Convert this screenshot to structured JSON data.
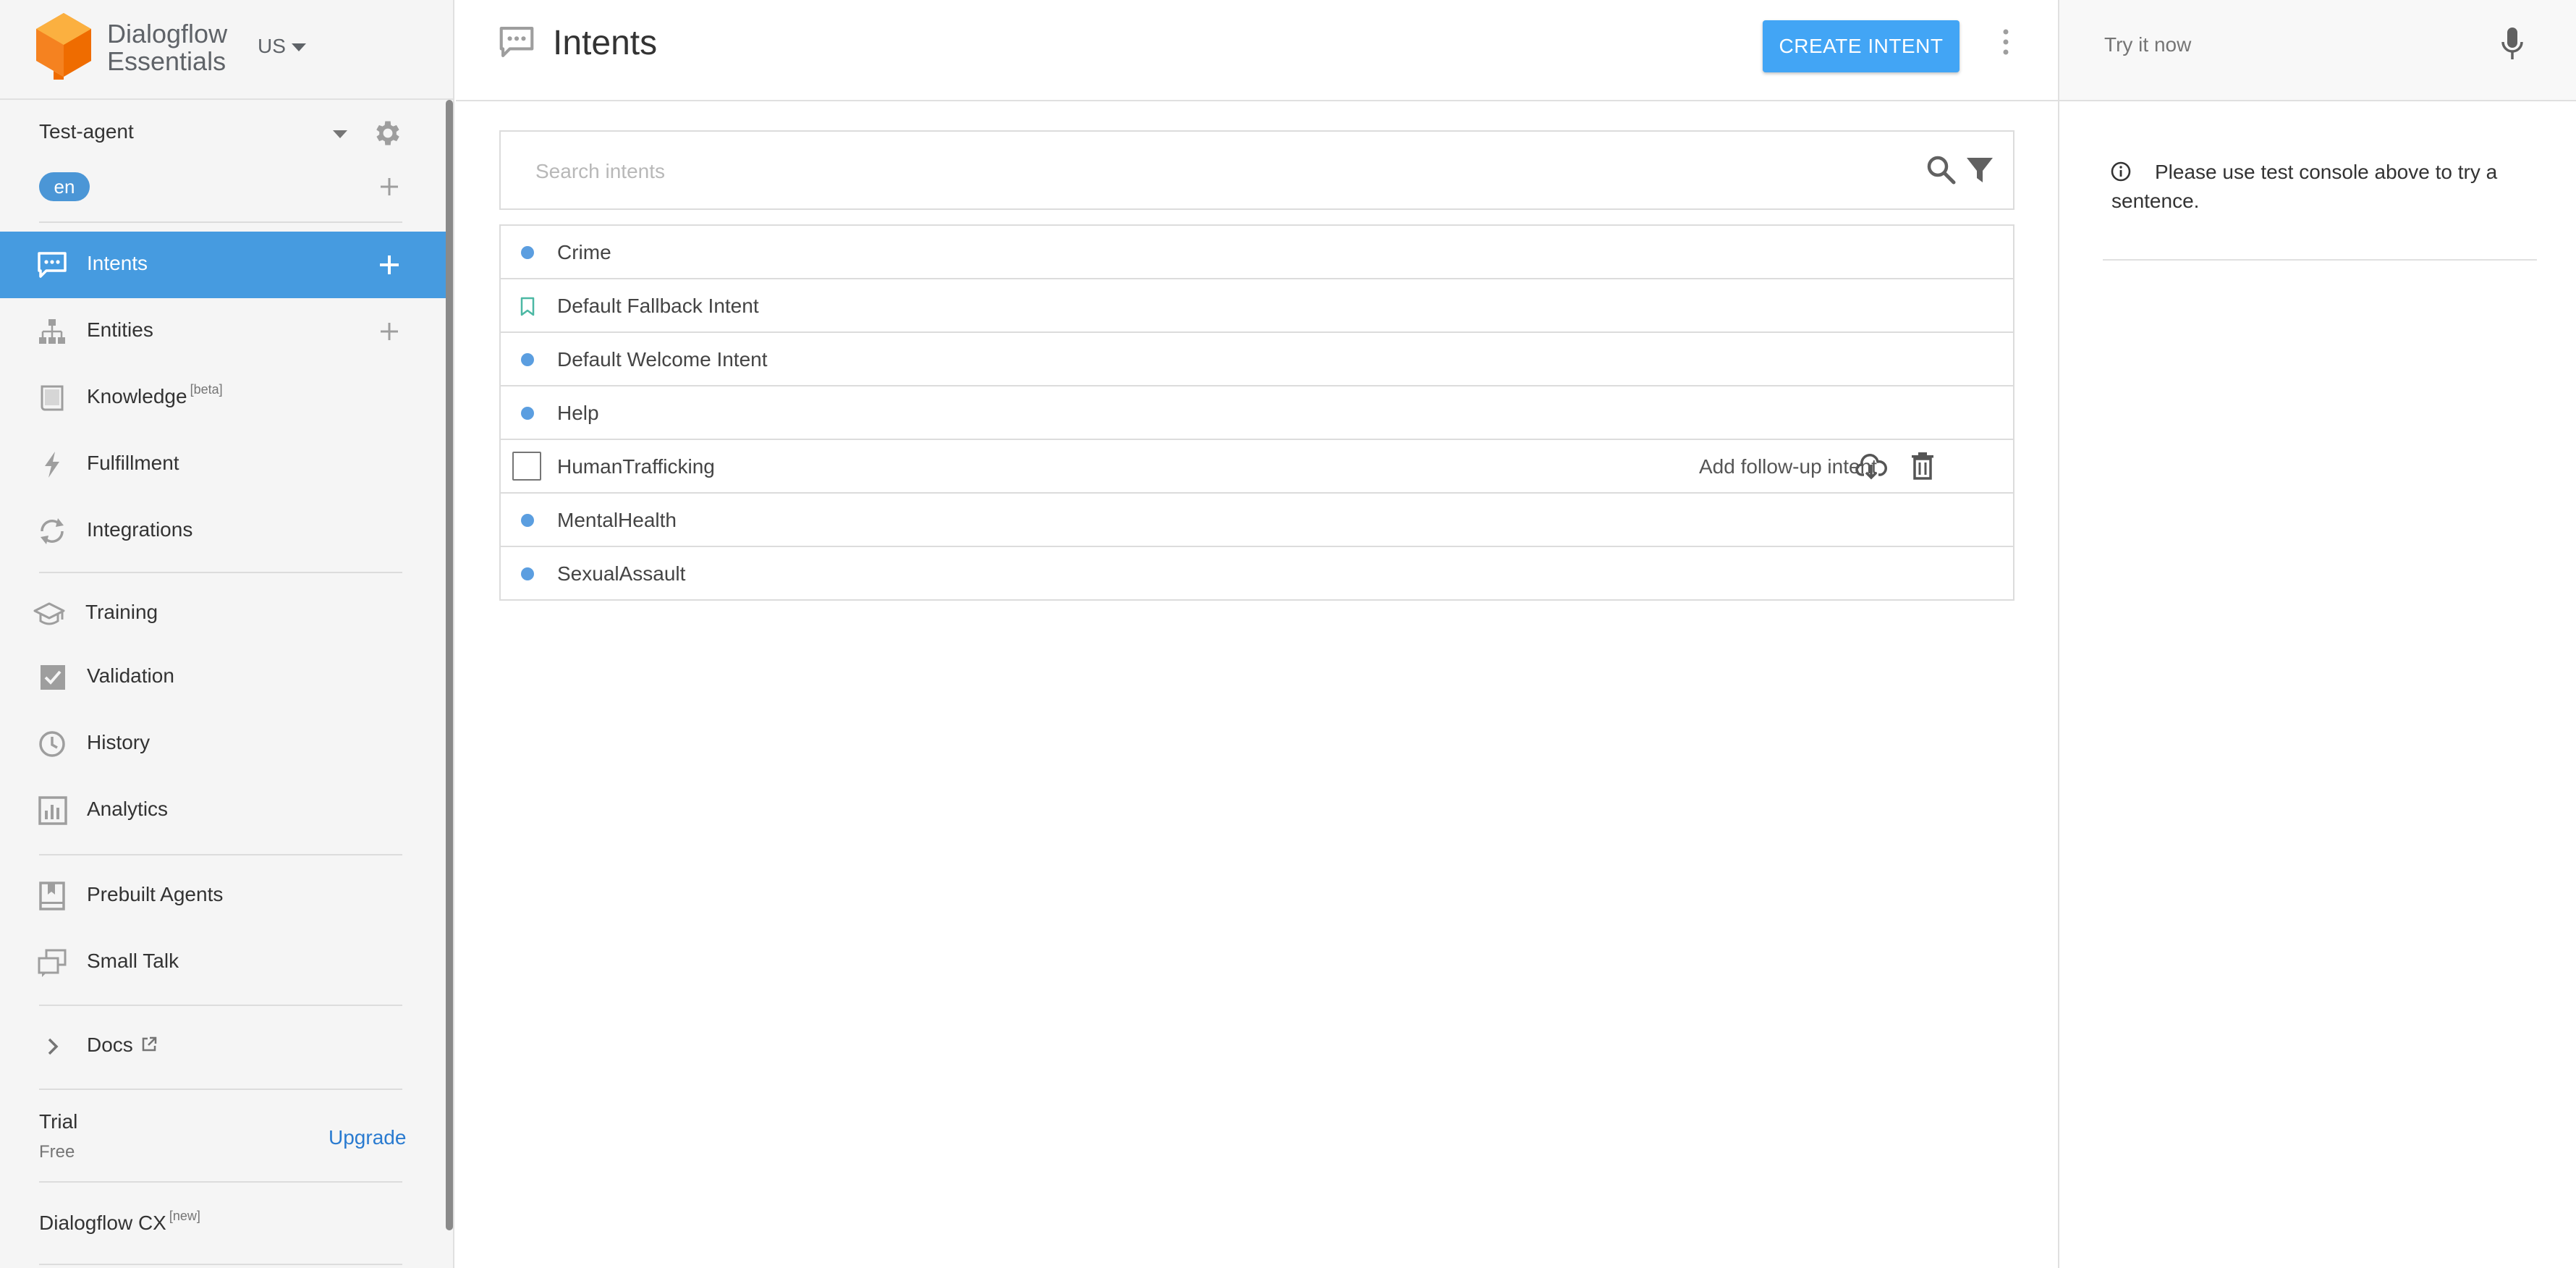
{
  "brand": {
    "line1": "Dialogflow",
    "line2": "Essentials",
    "region": "US"
  },
  "agent": {
    "name": "Test-agent",
    "language": "en"
  },
  "nav": {
    "intents": "Intents",
    "entities": "Entities",
    "knowledge": "Knowledge",
    "knowledge_tag": "[beta]",
    "fulfillment": "Fulfillment",
    "integrations": "Integrations",
    "training": "Training",
    "validation": "Validation",
    "history": "History",
    "analytics": "Analytics",
    "prebuilt_agents": "Prebuilt Agents",
    "small_talk": "Small Talk",
    "docs": "Docs"
  },
  "plan": {
    "label": "Trial",
    "sub": "Free",
    "upgrade": "Upgrade"
  },
  "cx": {
    "label": "Dialogflow CX",
    "tag": "[new]"
  },
  "header": {
    "title": "Intents",
    "create_button": "CREATE INTENT"
  },
  "search": {
    "placeholder": "Search intents"
  },
  "intents": [
    {
      "name": "Crime",
      "marker": "dot"
    },
    {
      "name": "Default Fallback Intent",
      "marker": "bookmark"
    },
    {
      "name": "Default Welcome Intent",
      "marker": "dot"
    },
    {
      "name": "Help",
      "marker": "dot"
    },
    {
      "name": "HumanTrafficking",
      "marker": "checkbox",
      "hover_action": "Add follow-up intent"
    },
    {
      "name": "MentalHealth",
      "marker": "dot"
    },
    {
      "name": "SexualAssault",
      "marker": "dot"
    }
  ],
  "console": {
    "placeholder": "Try it now",
    "info": "Please use test console above to try a sentence."
  },
  "colors": {
    "accent": "#469be0",
    "button": "#42a5f5",
    "dot": "#5b9ee0",
    "link": "#2a7bd0"
  }
}
